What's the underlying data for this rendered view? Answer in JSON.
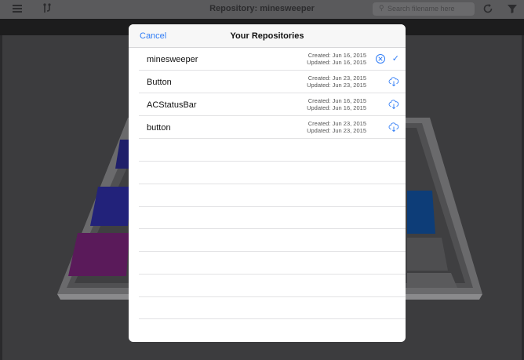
{
  "nav": {
    "title": "Repository: minesweeper",
    "search_placeholder": "Search filename here"
  },
  "modal": {
    "cancel_label": "Cancel",
    "title": "Your Repositories",
    "repositories": [
      {
        "name": "minesweeper",
        "created": "Created: Jun 16, 2015",
        "updated": "Updated: Jun 16, 2015",
        "action_icon": "close-circle-icon",
        "selected": true
      },
      {
        "name": "Button",
        "created": "Created: Jun 23, 2015",
        "updated": "Updated: Jun 23, 2015",
        "action_icon": "cloud-download-icon",
        "selected": false
      },
      {
        "name": "ACStatusBar",
        "created": "Created: Jun 16, 2015",
        "updated": "Updated: Jun 16, 2015",
        "action_icon": "cloud-download-icon",
        "selected": false
      },
      {
        "name": "button",
        "created": "Created: Jun 23, 2015",
        "updated": "Updated: Jun 23, 2015",
        "action_icon": "cloud-download-icon",
        "selected": false
      }
    ]
  },
  "colors": {
    "accent": "#2f7cf6"
  }
}
